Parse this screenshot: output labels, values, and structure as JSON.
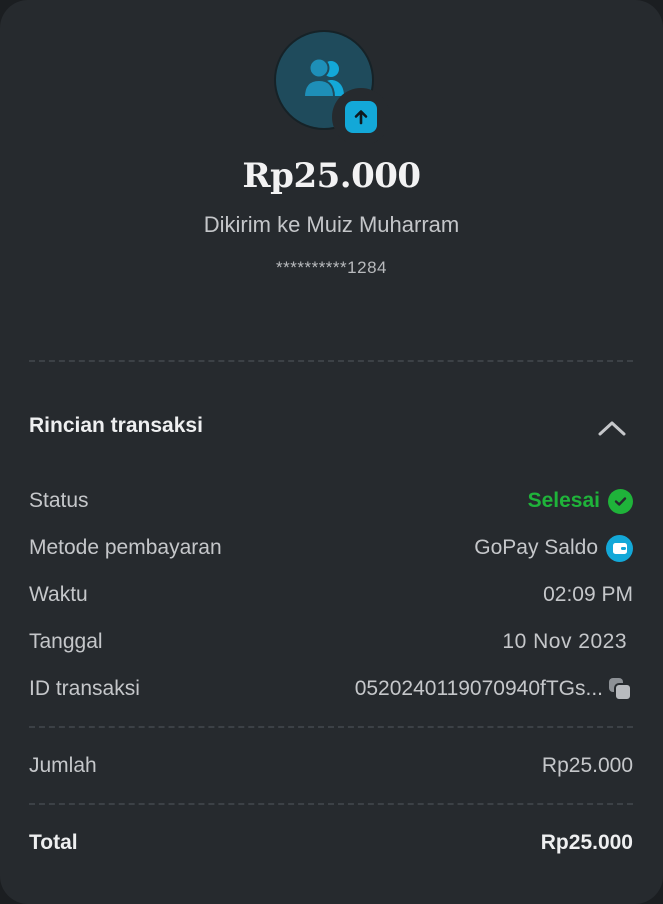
{
  "header": {
    "amount": "Rp25.000",
    "recipient_text": "Dikirim ke Muiz Muharram",
    "masked_account": "**********1284"
  },
  "details": {
    "title": "Rincian transaksi",
    "status_label": "Status",
    "status_value": "Selesai",
    "payment_method_label": "Metode pembayaran",
    "payment_method_value": "GoPay Saldo",
    "time_label": "Waktu",
    "time_value": "02:09 PM",
    "date_label": "Tanggal",
    "date_value": "10 Nov 2023",
    "transaction_id_label": "ID transaksi",
    "transaction_id_value": "0520240119070940fTGs..."
  },
  "summary": {
    "amount_label": "Jumlah",
    "amount_value": "Rp25.000",
    "total_label": "Total",
    "total_value": "Rp25.000"
  },
  "icons": {
    "avatar": "people-icon",
    "badge": "arrow-up-icon",
    "collapse": "chevron-up-icon",
    "status": "check-circle-icon",
    "payment": "wallet-icon",
    "copy": "copy-icon"
  },
  "colors": {
    "background": "#262a2e",
    "success": "#1fb33a",
    "accent": "#13a8d8",
    "avatar_bg": "#1f4b5c"
  }
}
